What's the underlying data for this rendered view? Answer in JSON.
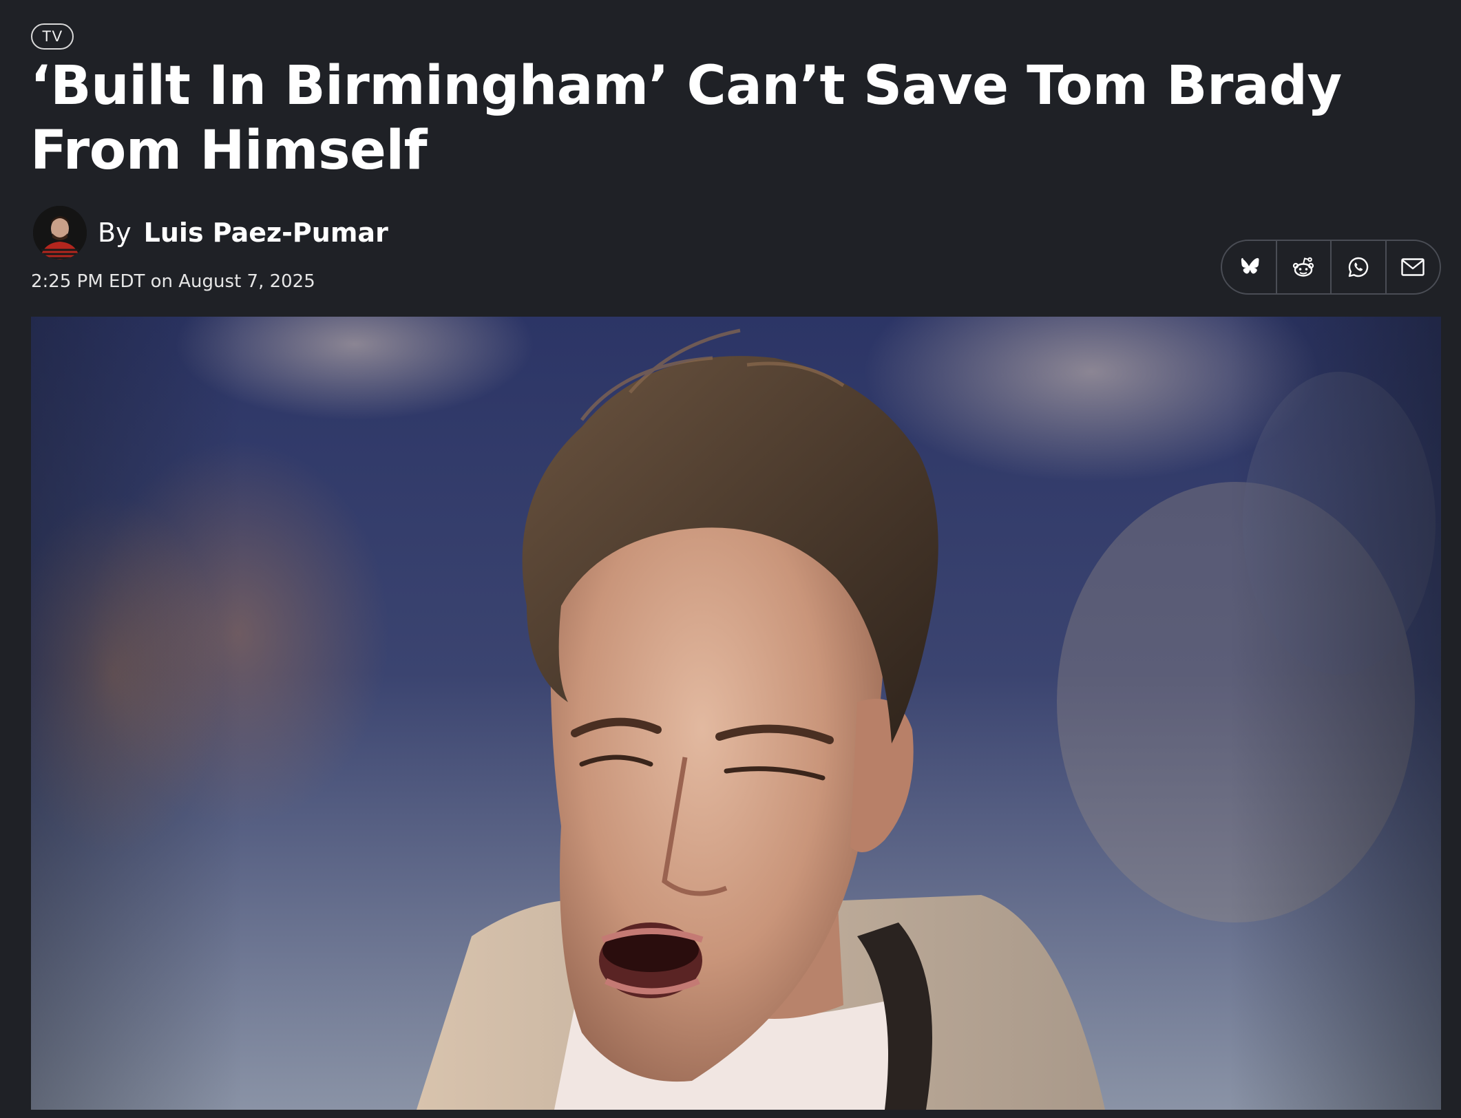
{
  "article": {
    "category": "TV",
    "headline": "‘Built In Birmingham’ Can’t Save Tom Brady From Himself",
    "byline_prefix": "By",
    "author": "Luis Paez-Pumar",
    "timestamp": "2:25 PM EDT on August 7, 2025"
  },
  "share": {
    "buttons": [
      {
        "icon": "bluesky-icon"
      },
      {
        "icon": "reddit-icon"
      },
      {
        "icon": "whatsapp-icon"
      },
      {
        "icon": "email-icon"
      }
    ]
  },
  "hero_image": {
    "subject": "photo-of-man-squinting"
  }
}
